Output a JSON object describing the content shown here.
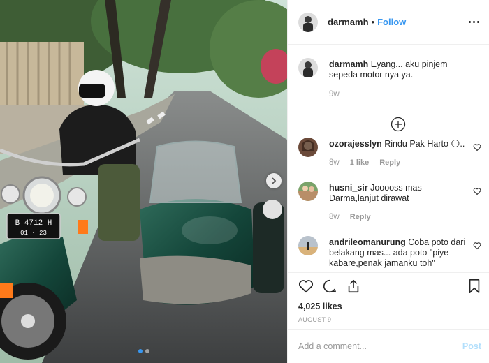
{
  "post": {
    "username": "darmamh",
    "separator": "•",
    "follow_label": "Follow",
    "more_icon": "more-icon"
  },
  "photo": {
    "plate_line1": "B 4712 H",
    "plate_line2": "01 · 23",
    "carousel_count": 2,
    "carousel_active": 1
  },
  "comments": [
    {
      "username": "darmamh",
      "text": "Eyang... aku pinjem sepeda motor nya ya.",
      "time": "9w"
    },
    {
      "username": "ozorajesslyn",
      "text": "Rindu Pak Harto 🌕..",
      "time": "8w",
      "likes": "1 like",
      "reply": "Reply"
    },
    {
      "username": "husni_sir",
      "text": "Jooooss mas Darma,lanjut dirawat",
      "time": "8w",
      "reply": "Reply"
    },
    {
      "username": "andrileomanurung",
      "text": "Coba poto dari belakang mas... ada poto \"piye kabare,penak jamanku toh\""
    }
  ],
  "actions": {
    "likes": "4,025 likes",
    "date": "AUGUST 9"
  },
  "composer": {
    "placeholder": "Add a comment...",
    "post_label": "Post"
  },
  "colors": {
    "accent": "#3897f0",
    "text": "#262626",
    "muted": "#999999",
    "border": "#efefef",
    "post_disabled": "#b2dffc"
  }
}
